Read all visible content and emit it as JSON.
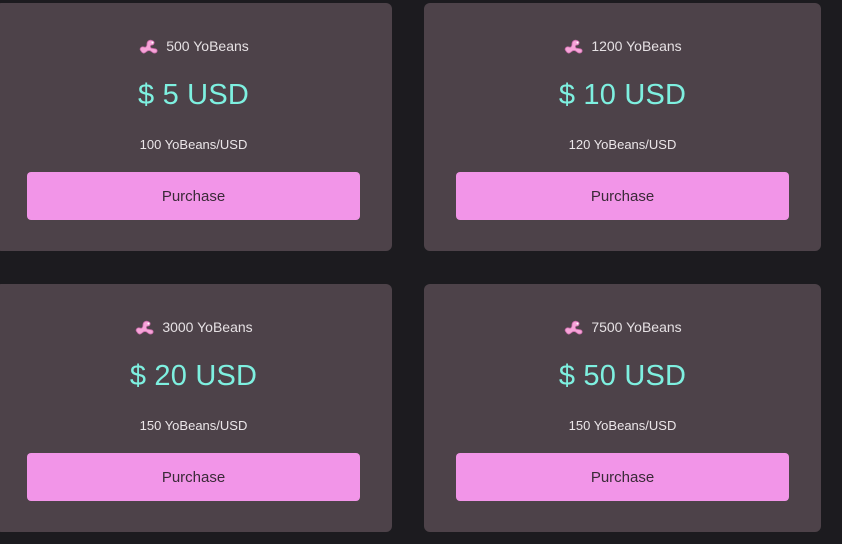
{
  "packages": [
    {
      "amount": "500 YoBeans",
      "price": "$ 5 USD",
      "rate": "100 YoBeans/USD",
      "button_label": "Purchase"
    },
    {
      "amount": "1200 YoBeans",
      "price": "$ 10 USD",
      "rate": "120 YoBeans/USD",
      "button_label": "Purchase"
    },
    {
      "amount": "3000 YoBeans",
      "price": "$ 20 USD",
      "rate": "150 YoBeans/USD",
      "button_label": "Purchase"
    },
    {
      "amount": "7500 YoBeans",
      "price": "$ 50 USD",
      "rate": "150 YoBeans/USD",
      "button_label": "Purchase"
    }
  ],
  "icons": {
    "currency": "yobean-icon"
  },
  "colors": {
    "background": "#1c1b1f",
    "card": "#4d4249",
    "price": "#7ef0e0",
    "button": "#f295e8",
    "button_text": "#3a2a38"
  }
}
